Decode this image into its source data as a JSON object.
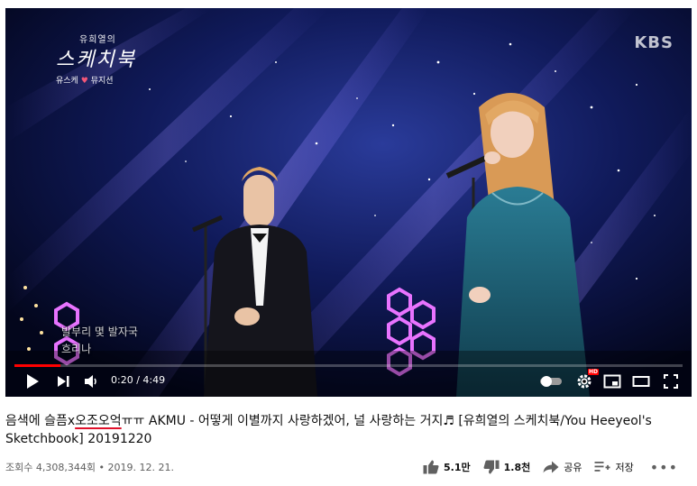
{
  "overlay": {
    "logo_small": "유희열의",
    "logo_big": "스케치북",
    "logo_sub_left": "유스케",
    "logo_sub_right": "뮤지션",
    "broadcaster": "KBS",
    "subtitle_line1": "발부리 몇 발자국",
    "subtitle_line2": "흐리나"
  },
  "player": {
    "time": "0:20 / 4:49",
    "progress_fraction": 0.069,
    "progress_color": "#ff0000",
    "icons": [
      "play-icon",
      "next-icon",
      "volume-icon",
      "autoplay-toggle",
      "settings-gear-icon",
      "miniplayer-icon",
      "theater-icon",
      "fullscreen-icon"
    ],
    "hd_badge": "HD"
  },
  "video": {
    "title_pre": "음색에 슬픔x",
    "title_mark": "오조오억",
    "title_post": "ㅠㅠ AKMU - 어떻게 이별까지 사랑하겠어, 널 사랑하는 거지♬ [유희열의 스케치북/You Heeyeol's Sketchbook] 20191220",
    "views": "조회수 4,308,344회",
    "dot": "•",
    "date": "2019. 12. 21.",
    "title_mark_color": "#e0102a"
  },
  "actions": {
    "like_count": "5.1만",
    "dislike_count": "1.8천",
    "share_label": "공유",
    "save_label": "저장",
    "more_label": "•••"
  }
}
